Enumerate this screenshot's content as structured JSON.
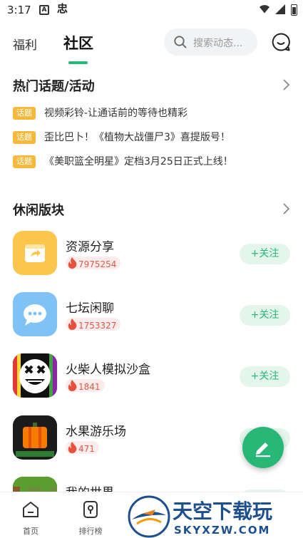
{
  "status_bar": {
    "time": "3:17"
  },
  "header": {
    "tabs": [
      {
        "label": "福利",
        "active": false
      },
      {
        "label": "社区",
        "active": true
      }
    ],
    "search": {
      "placeholder": "搜索动态..."
    },
    "accent_color": "#27b776"
  },
  "hot_topics": {
    "title": "热门话题/活动",
    "tag_label": "话题",
    "items": [
      {
        "text": "视频彩铃-让通话前的等待也精彩"
      },
      {
        "text": "歪比巴卜！《植物大战僵尸3》喜提版号！"
      },
      {
        "text": "《美职篮全明星》定档3月25日正式上线！"
      }
    ]
  },
  "leisure": {
    "title": "休闲版块",
    "follow_label": "+关注",
    "forums": [
      {
        "name": "资源分享",
        "heat": "7975254",
        "icon": "share-box-icon"
      },
      {
        "name": "七坛闲聊",
        "heat": "1753327",
        "icon": "chat-bubble-icon"
      },
      {
        "name": "火柴人模拟沙盒",
        "heat": "1841",
        "icon": "stickman-face-icon"
      },
      {
        "name": "水果游乐场",
        "heat": "471",
        "icon": "pumpkin-icon"
      },
      {
        "name": "我的世界",
        "heat": "",
        "icon": "minecraft-icon"
      }
    ]
  },
  "bottom_nav": {
    "items": [
      {
        "label": "首页",
        "icon": "home-icon"
      },
      {
        "label": "排行榜",
        "icon": "ranking-icon"
      }
    ]
  },
  "watermark": {
    "title": "天空下载玩",
    "domain": "SKYXZW.COM"
  }
}
